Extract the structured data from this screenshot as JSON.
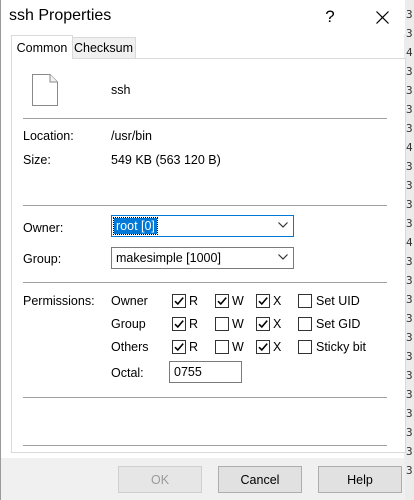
{
  "window": {
    "title": "ssh Properties",
    "help_glyph": "?"
  },
  "tabs": [
    {
      "label": "Common",
      "active": true
    },
    {
      "label": "Checksum",
      "active": false
    }
  ],
  "file": {
    "name": "ssh",
    "icon": "file-icon"
  },
  "info": {
    "location_label": "Location:",
    "location_value": "/usr/bin",
    "size_label": "Size:",
    "size_value": "549 KB (563 120 B)"
  },
  "owner": {
    "label": "Owner:",
    "value": "root [0]"
  },
  "group": {
    "label": "Group:",
    "value": "makesimple [1000]"
  },
  "permissions": {
    "label": "Permissions:",
    "rows": [
      {
        "name": "Owner",
        "r": true,
        "w": true,
        "x": true,
        "extra_label": "Set UID",
        "extra": false
      },
      {
        "name": "Group",
        "r": true,
        "w": false,
        "x": true,
        "extra_label": "Set GID",
        "extra": false
      },
      {
        "name": "Others",
        "r": true,
        "w": false,
        "x": true,
        "extra_label": "Sticky bit",
        "extra": false
      }
    ],
    "r_label": "R",
    "w_label": "W",
    "x_label": "X",
    "octal_label": "Octal:",
    "octal_value": "0755"
  },
  "buttons": {
    "ok": "OK",
    "cancel": "Cancel",
    "help": "Help"
  },
  "background_digits": [
    "3",
    "3",
    "4",
    "3",
    "3",
    "3",
    "3",
    "4",
    "3",
    "3",
    "3",
    "3",
    "4",
    "3",
    "3",
    "3",
    "3",
    "3",
    "3",
    "3",
    "3",
    "3",
    "3",
    "3",
    "3"
  ]
}
